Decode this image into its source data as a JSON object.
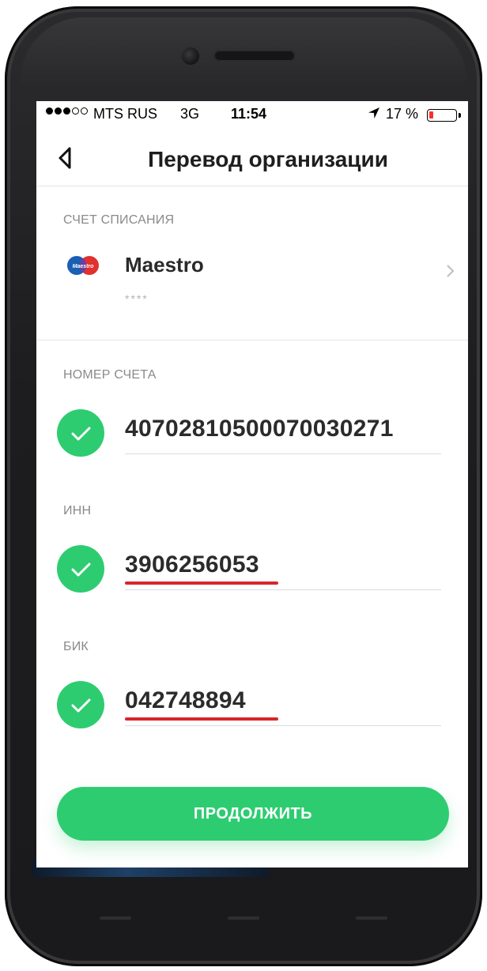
{
  "status_bar": {
    "carrier": "MTS RUS",
    "network": "3G",
    "time": "11:54",
    "battery_text": "17 %",
    "battery_level": 0.17,
    "signal_strength": 3,
    "signal_max": 5
  },
  "header": {
    "title": "Перевод организации"
  },
  "debit_account": {
    "section_label": "СЧЕТ СПИСАНИЯ",
    "card_logo_text": "Maestro",
    "card_name": "Maestro",
    "card_mask": "****"
  },
  "fields": {
    "account_number": {
      "label": "НОМЕР СЧЕТА",
      "value": "40702810500070030271"
    },
    "inn": {
      "label": "ИНН",
      "value": "3906256053"
    },
    "bik": {
      "label": "БИК",
      "value": "042748894"
    }
  },
  "actions": {
    "continue_label": "ПРОДОЛЖИТЬ"
  },
  "colors": {
    "accent_green": "#2ecc71",
    "highlight_red": "#d7262b",
    "battery_red": "#ff2d2d",
    "maestro_blue": "#1a5fb4",
    "maestro_red": "#e0312e"
  },
  "icons": {
    "back": "back-arrow-icon",
    "chevron": "chevron-right-icon",
    "check": "check-icon",
    "location": "location-arrow-icon"
  }
}
